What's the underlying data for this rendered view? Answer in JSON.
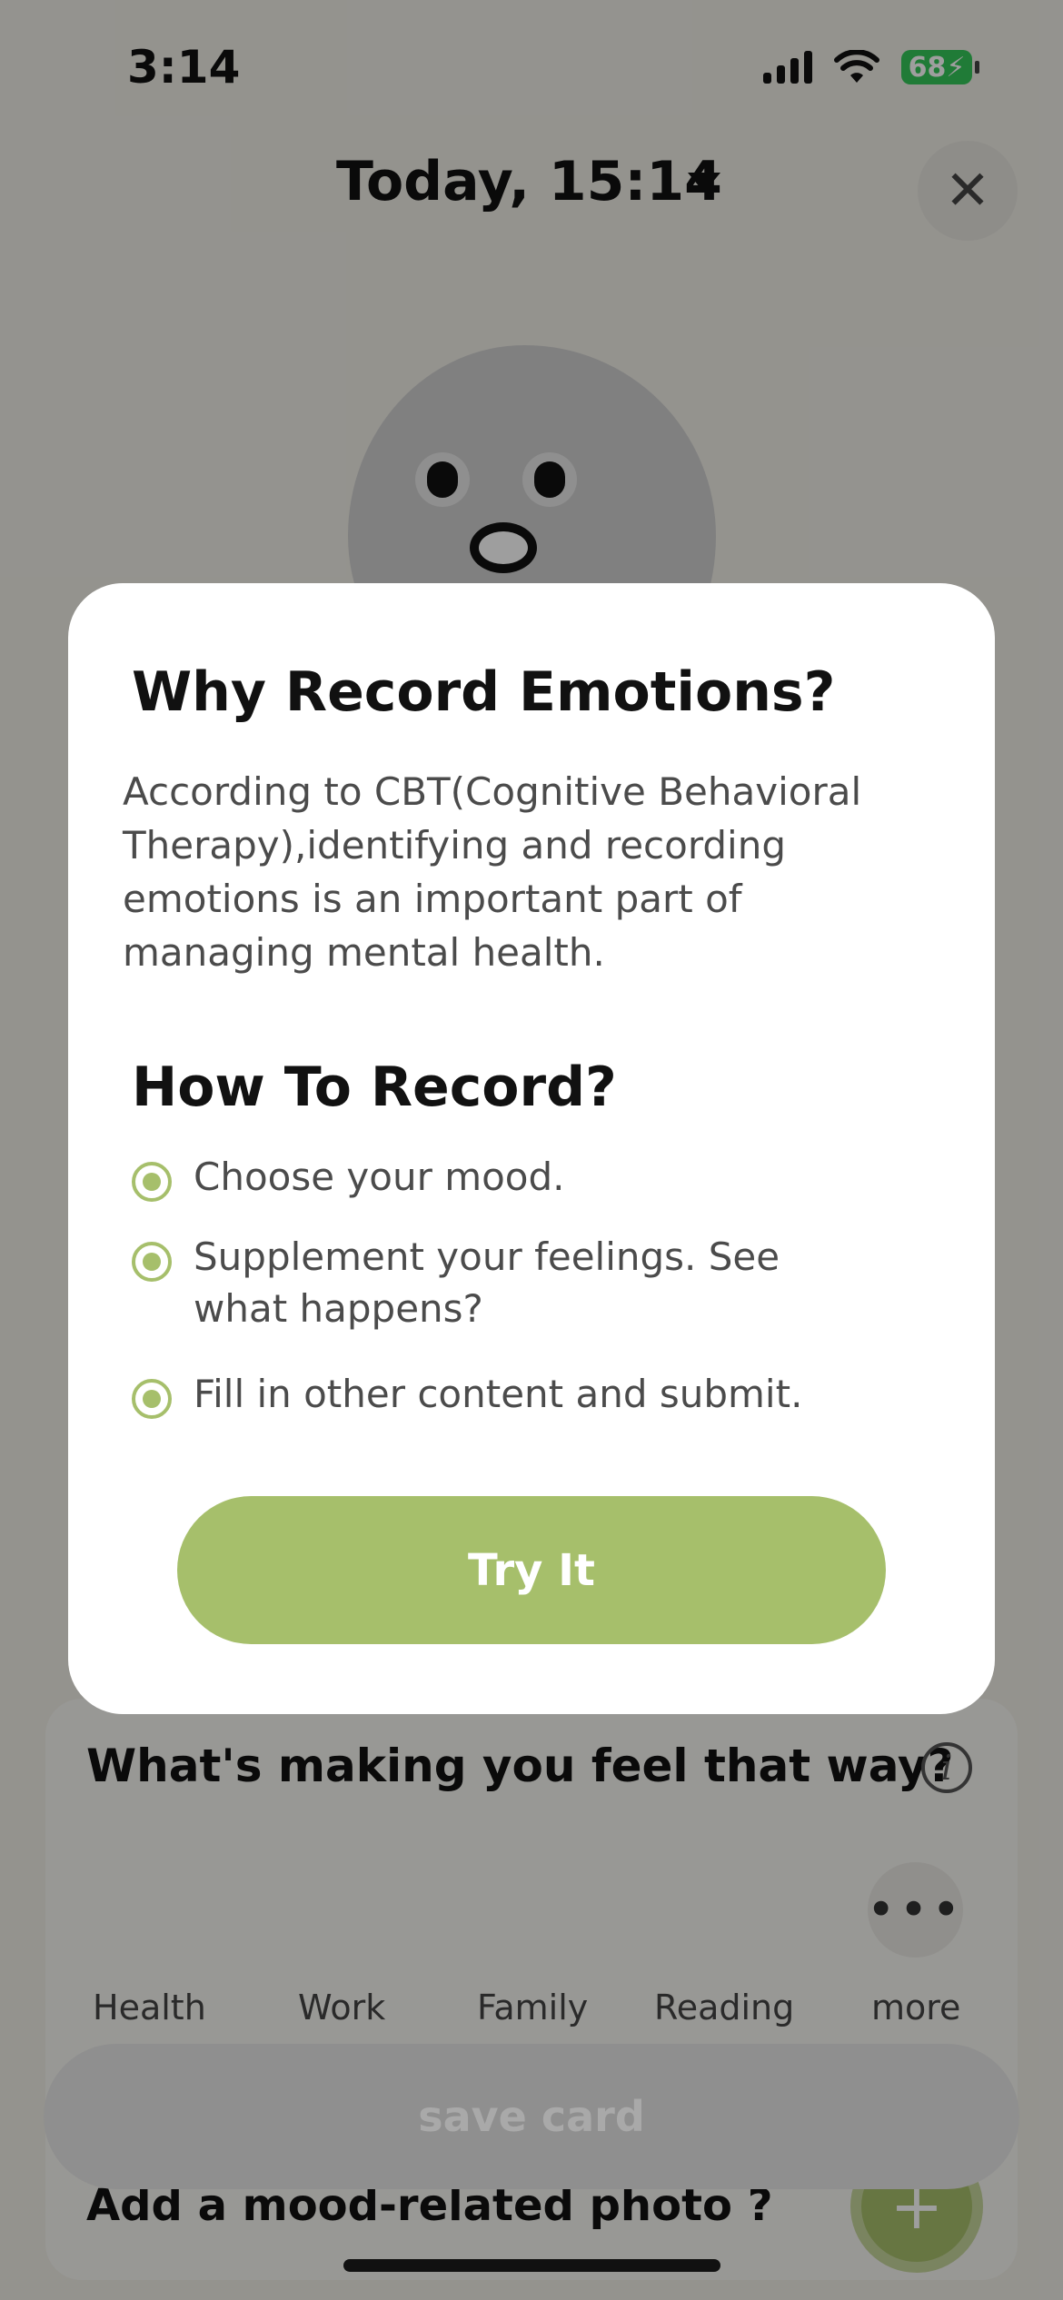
{
  "status_bar": {
    "time": "3:14",
    "battery": "68"
  },
  "header": {
    "title": "Today, 15:14"
  },
  "background": {
    "card_title": "What's making you feel that way?",
    "categories": [
      "Health",
      "Work",
      "Family",
      "Reading",
      "more"
    ],
    "save_label": "save card",
    "photo_prompt": "Add a mood-related photo ?"
  },
  "modal": {
    "title": "Why Record Emotions?",
    "body": "According to CBT(Cognitive Behavioral Therapy),identifying and recording emotions is an important part of managing mental health.",
    "subtitle": "How To Record?",
    "steps": [
      "Choose your mood.",
      "Supplement your feelings. See what happens?",
      "Fill in other content and submit."
    ],
    "cta": "Try It"
  },
  "colors": {
    "accent": "#a6bf6b",
    "battery": "#35c759"
  }
}
